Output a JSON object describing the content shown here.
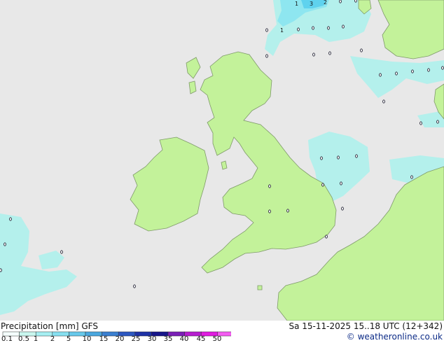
{
  "map": {
    "sea_color": "#e8e8e8",
    "land_color": "#c3f29a",
    "coast_color": "#7f9a6a",
    "precip_light_color": "#b4f0ec",
    "precip_mid_color": "#8ee6f0",
    "precip_high_color": "#5fd2ee",
    "point_labels": [
      "1",
      "3",
      "2",
      "1"
    ]
  },
  "footer": {
    "legend_title": "Precipitation [mm]  GFS",
    "run_info": "Sa 15-11-2025 15..18 UTC (12+342)",
    "credit": "© weatheronline.co.uk"
  },
  "scale": {
    "labels": [
      "0.1",
      "0.5",
      "1",
      "2",
      "5",
      "10",
      "15",
      "20",
      "25",
      "30",
      "35",
      "40",
      "45",
      "50"
    ],
    "colors": [
      "#f5fffc",
      "#c9f7ef",
      "#a6eff2",
      "#86dff0",
      "#66c8ea",
      "#4aa7de",
      "#3a7fd0",
      "#2c57c0",
      "#1e32a6",
      "#16158a",
      "#7a1fb6",
      "#b61dcf",
      "#e01be0",
      "#f45cf2"
    ]
  }
}
